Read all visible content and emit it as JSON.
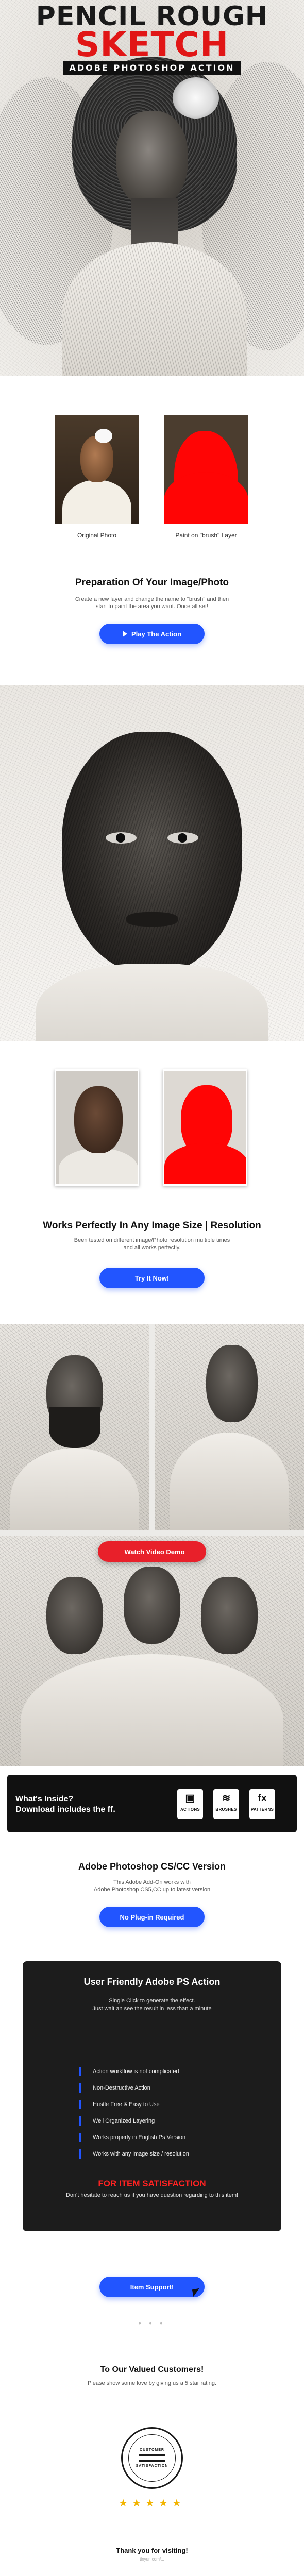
{
  "hero": {
    "line1": "PENCIL ROUGH",
    "line2": "SKETCH",
    "line3": "ADOBE PHOTOSHOP ACTION"
  },
  "compare": {
    "left_caption": "Original Photo",
    "right_caption": "Paint on \"brush\" Layer"
  },
  "prepare": {
    "heading": "Preparation Of Your Image/Photo",
    "desc_line1": "Create a new layer and change the name to \"brush\" and then",
    "desc_line2": "start to paint the area you want. Once all set!",
    "button": "Play The Action"
  },
  "resolution": {
    "heading": "Works Perfectly In Any Image Size | Resolution",
    "desc_line1": "Been tested on different image/Photo resolution multiple times",
    "desc_line2": "and all works perfectly.",
    "button": "Try It Now!"
  },
  "video": {
    "button": "Watch Video Demo"
  },
  "inside": {
    "title_line1": "What's Inside?",
    "title_line2": "Download includes the ff.",
    "items": [
      {
        "glyph": "▣",
        "label": "ACTIONS",
        "icon": "actions-icon"
      },
      {
        "glyph": "≋",
        "label": "BRUSHES",
        "icon": "brushes-icon"
      },
      {
        "glyph": "fx",
        "label": "PATTERNS",
        "icon": "patterns-icon"
      }
    ]
  },
  "version": {
    "heading": "Adobe Photoshop CS/CC Version",
    "desc_line1": "This Adobe Add-On works with",
    "desc_line2": "Adobe Photoshop CS5,CC up to latest version",
    "button": "No Plug-in Required"
  },
  "friendly": {
    "heading": "User Friendly Adobe PS Action",
    "desc_line1": "Single Click to generate the effect.",
    "desc_line2": "Just wait an see the result in less than a minute",
    "features": [
      "Action workflow is not complicated",
      "Non-Destructive Action",
      "Hustle Free & Easy to Use",
      "Well Organized Layering",
      "Works properly in English Ps Version",
      "Works with any image size / resolution"
    ],
    "support_title": "FOR ITEM SATISFACTION",
    "support_text": "Don't hesitate to reach us if you have question regarding to this item!",
    "button": "Item Support!"
  },
  "valued": {
    "heading": "To Our Valued Customers!",
    "text": "Please show some love by giving us a 5 star rating.",
    "badge_top": "CUSTOMER",
    "badge_bottom": "SATISFACTION",
    "stars": "★★★★★",
    "thanks": "Thank you for visiting!",
    "small": "tinyurl.com/..."
  },
  "colors": {
    "accent_blue": "#2255ff",
    "accent_red": "#e11616",
    "dark": "#111111"
  }
}
